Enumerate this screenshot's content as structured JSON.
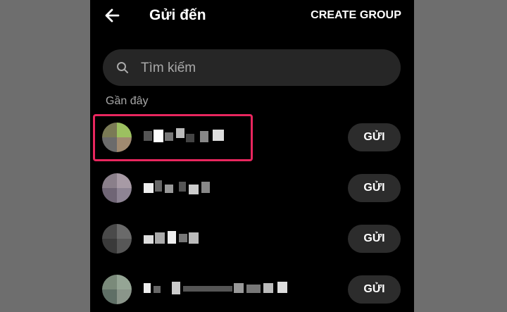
{
  "header": {
    "title": "Gửi đến",
    "create_group_label": "CREATE GROUP"
  },
  "search": {
    "placeholder": "Tìm kiếm",
    "value": ""
  },
  "section": {
    "label": "Gần đây"
  },
  "contacts": [
    {
      "send_label": "GỬI",
      "highlighted": true
    },
    {
      "send_label": "GỬI",
      "highlighted": false
    },
    {
      "send_label": "GỬI",
      "highlighted": false
    },
    {
      "send_label": "GỬI",
      "highlighted": false
    }
  ],
  "colors": {
    "background": "#000000",
    "outside": "#6e6e6e",
    "search_bg": "#262626",
    "button_bg": "#2c2c2c",
    "highlight": "#e8265e",
    "muted_text": "#a8a8a8"
  },
  "icons": {
    "back": "arrow-left-icon",
    "search": "search-icon"
  }
}
